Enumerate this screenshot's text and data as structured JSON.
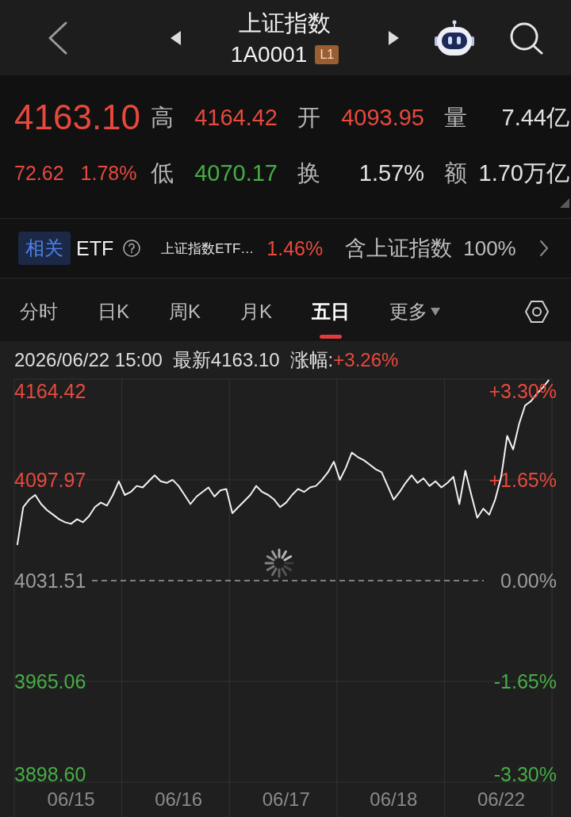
{
  "header": {
    "title": "上证指数",
    "code": "1A0001",
    "level_badge": "L1"
  },
  "quote": {
    "price": "4163.10",
    "change": "72.62",
    "change_pct": "1.78%",
    "color": "#e8493d",
    "stats": [
      {
        "label": "高",
        "value": "4164.42",
        "color": "#e8493d"
      },
      {
        "label": "开",
        "value": "4093.95",
        "color": "#e8493d"
      },
      {
        "label": "量",
        "value": "7.44亿",
        "color": "#e2e2e2"
      },
      {
        "label": "低",
        "value": "4070.17",
        "color": "#46ad46"
      },
      {
        "label": "换",
        "value": "1.57%",
        "color": "#e2e2e2"
      },
      {
        "label": "额",
        "value": "1.70万亿",
        "color": "#e2e2e2"
      }
    ]
  },
  "etf_bar": {
    "tag": "相关",
    "title": "ETF",
    "fund": {
      "name": "上证指数ETF…",
      "change": "1.46%",
      "color": "#e8493d"
    },
    "holding_label": "含上证指数",
    "holding_share": "100%"
  },
  "tabs": [
    {
      "label": "分时",
      "selected": false,
      "kind": "plain"
    },
    {
      "label": "日K",
      "selected": false,
      "kind": "plain"
    },
    {
      "label": "周K",
      "selected": false,
      "kind": "plain"
    },
    {
      "label": "月K",
      "selected": false,
      "kind": "plain"
    },
    {
      "label": "五日",
      "selected": true,
      "kind": "plain"
    },
    {
      "label": "更多",
      "selected": false,
      "kind": "dropdown"
    }
  ],
  "chart": {
    "timestamp": "2026/06/22 15:00",
    "latest": "最新4163.10",
    "change": {
      "label": "涨幅:",
      "value": "+3.26%",
      "color": "#e8493d"
    },
    "right_ticks": [
      {
        "label": "+3.30%",
        "color": "#e8493d"
      },
      {
        "label": "+1.65%",
        "color": "#e8493d"
      },
      {
        "label": "0.00%",
        "color": "#9c9c9c"
      },
      {
        "label": "-1.65%",
        "color": "#46ad46"
      },
      {
        "label": "-3.30%",
        "color": "#46ad46"
      }
    ],
    "chart_data": {
      "type": "line",
      "ylim": [
        3898.6,
        4164.42
      ],
      "yticks": [
        {
          "value": 4164.42,
          "label": "4164.42"
        },
        {
          "value": 4097.97,
          "label": "4097.97"
        },
        {
          "value": 4031.51,
          "label": "4031.51"
        },
        {
          "value": 3965.06,
          "label": "3965.06"
        },
        {
          "value": 3898.6,
          "label": "3898.60"
        }
      ],
      "categories": [
        null,
        null,
        null,
        null,
        null,
        null,
        null,
        null,
        null,
        "06/15",
        null,
        null,
        null,
        null,
        null,
        null,
        null,
        null,
        null,
        null,
        null,
        null,
        null,
        null,
        null,
        null,
        null,
        "06/16",
        null,
        null,
        null,
        null,
        null,
        null,
        null,
        null,
        null,
        null,
        null,
        null,
        null,
        null,
        null,
        null,
        null,
        "06/17",
        null,
        null,
        null,
        null,
        null,
        null,
        null,
        null,
        null,
        null,
        null,
        null,
        null,
        null,
        null,
        null,
        null,
        "06/18",
        null,
        null,
        null,
        null,
        null,
        null,
        null,
        null,
        null,
        null,
        null,
        null,
        null,
        null,
        null,
        null,
        null,
        "06/22",
        null,
        null,
        null,
        null,
        null,
        null,
        null,
        null
      ],
      "series": [
        {
          "values": [
            4055,
            4080,
            4085,
            4088,
            4082,
            4078,
            4075,
            4072,
            4070,
            4069,
            4072,
            4070,
            4074,
            4080,
            4083,
            4081,
            4088,
            4097,
            4088,
            4090,
            4094,
            4093,
            4097,
            4101,
            4097,
            4096,
            4098,
            4094,
            4088,
            4082,
            4087,
            4090,
            4093,
            4087,
            4091,
            4092,
            4076,
            4080,
            4084,
            4088,
            4094,
            4090,
            4088,
            4085,
            4080,
            4083,
            4088,
            4092,
            4090,
            4093,
            4094,
            4098,
            4103,
            4110,
            4098,
            4106,
            4116,
            4113,
            4111,
            4108,
            4105,
            4103,
            4094,
            4085,
            4090,
            4096,
            4101,
            4096,
            4099,
            4094,
            4097,
            4093,
            4096,
            4100,
            4082,
            4104,
            4088,
            4073,
            4079,
            4075,
            4085,
            4100,
            4127,
            4118,
            4135,
            4147,
            4150,
            4155,
            4159,
            4164
          ]
        }
      ]
    }
  }
}
